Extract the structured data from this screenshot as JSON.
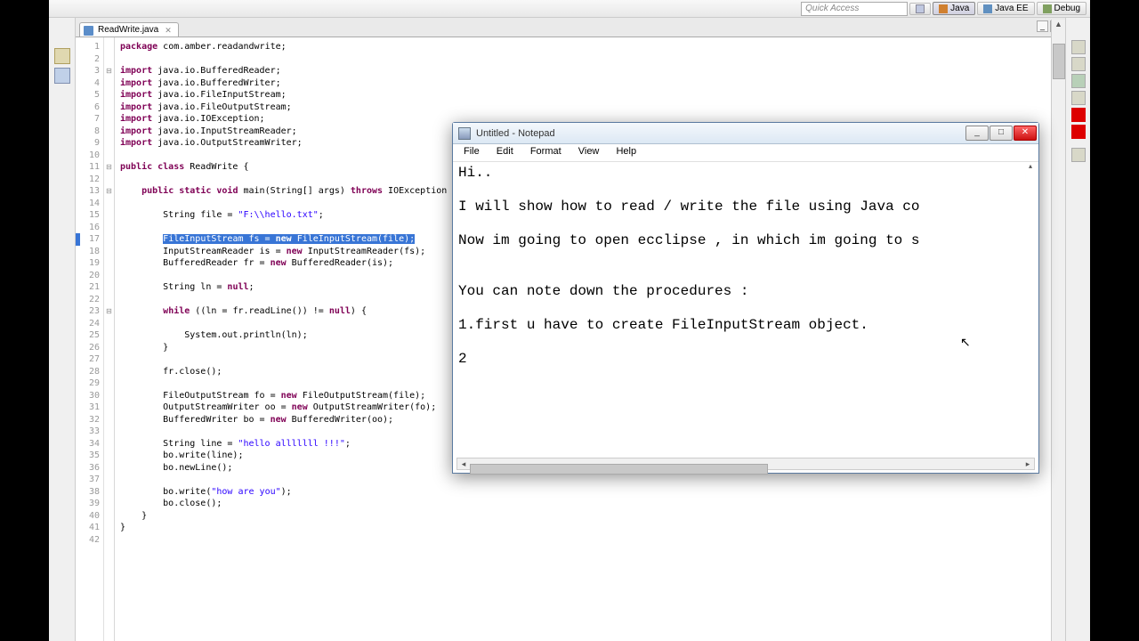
{
  "toolbar": {
    "quick_access_placeholder": "Quick Access",
    "perspectives": [
      "Java",
      "Java EE",
      "Debug"
    ]
  },
  "editor": {
    "tab_title": "ReadWrite.java",
    "line_count": 42,
    "code_lines": [
      {
        "n": 1,
        "h": "<span class='kw'>package</span> com.amber.readandwrite;"
      },
      {
        "n": 2,
        "h": ""
      },
      {
        "n": 3,
        "h": "<span class='kw'>import</span> java.io.BufferedReader;"
      },
      {
        "n": 4,
        "h": "<span class='kw'>import</span> java.io.BufferedWriter;"
      },
      {
        "n": 5,
        "h": "<span class='kw'>import</span> java.io.FileInputStream;"
      },
      {
        "n": 6,
        "h": "<span class='kw'>import</span> java.io.FileOutputStream;"
      },
      {
        "n": 7,
        "h": "<span class='kw'>import</span> java.io.IOException;"
      },
      {
        "n": 8,
        "h": "<span class='kw'>import</span> java.io.InputStreamReader;"
      },
      {
        "n": 9,
        "h": "<span class='kw'>import</span> java.io.OutputStreamWriter;"
      },
      {
        "n": 10,
        "h": ""
      },
      {
        "n": 11,
        "h": "<span class='kw'>public class</span> ReadWrite {"
      },
      {
        "n": 12,
        "h": ""
      },
      {
        "n": 13,
        "h": "    <span class='kw'>public static void</span> main(String[] args) <span class='kw'>throws</span> IOException {"
      },
      {
        "n": 14,
        "h": ""
      },
      {
        "n": 15,
        "h": "        String file = <span class='str'>\"F:\\\\hello.txt\"</span>;"
      },
      {
        "n": 16,
        "h": ""
      },
      {
        "n": 17,
        "h": "        <span class='sel'>FileInputStream fs = <span class='kw'>new</span> FileInputStream(file);</span>"
      },
      {
        "n": 18,
        "h": "        InputStreamReader is = <span class='kw'>new</span> InputStreamReader(fs);"
      },
      {
        "n": 19,
        "h": "        BufferedReader fr = <span class='kw'>new</span> BufferedReader(is);"
      },
      {
        "n": 20,
        "h": ""
      },
      {
        "n": 21,
        "h": "        String ln = <span class='kw'>null</span>;"
      },
      {
        "n": 22,
        "h": ""
      },
      {
        "n": 23,
        "h": "        <span class='kw'>while</span> ((ln = fr.readLine()) != <span class='kw'>null</span>) {"
      },
      {
        "n": 24,
        "h": ""
      },
      {
        "n": 25,
        "h": "            System.out.println(ln);"
      },
      {
        "n": 26,
        "h": "        }"
      },
      {
        "n": 27,
        "h": ""
      },
      {
        "n": 28,
        "h": "        fr.close();"
      },
      {
        "n": 29,
        "h": ""
      },
      {
        "n": 30,
        "h": "        FileOutputStream fo = <span class='kw'>new</span> FileOutputStream(file);"
      },
      {
        "n": 31,
        "h": "        OutputStreamWriter oo = <span class='kw'>new</span> OutputStreamWriter(fo);"
      },
      {
        "n": 32,
        "h": "        BufferedWriter bo = <span class='kw'>new</span> BufferedWriter(oo);"
      },
      {
        "n": 33,
        "h": ""
      },
      {
        "n": 34,
        "h": "        String line = <span class='str'>\"hello alllllll !!!\"</span>;"
      },
      {
        "n": 35,
        "h": "        bo.write(line);"
      },
      {
        "n": 36,
        "h": "        bo.newLine();"
      },
      {
        "n": 37,
        "h": ""
      },
      {
        "n": 38,
        "h": "        bo.write(<span class='str'>\"how are you\"</span>);"
      },
      {
        "n": 39,
        "h": "        bo.close();"
      },
      {
        "n": 40,
        "h": "    }"
      },
      {
        "n": 41,
        "h": "}"
      },
      {
        "n": 42,
        "h": ""
      }
    ]
  },
  "notepad": {
    "title": "Untitled - Notepad",
    "menu": [
      "File",
      "Edit",
      "Format",
      "View",
      "Help"
    ],
    "body": "Hi..\n\nI will show how to read / write the file using Java co\n\nNow im going to open ecclipse , in which im going to s\n\n\nYou can note down the procedures :\n\n1.first u have to create FileInputStream object.\n\n2",
    "min_tip": "_",
    "max_tip": "□",
    "close_tip": "✕"
  }
}
